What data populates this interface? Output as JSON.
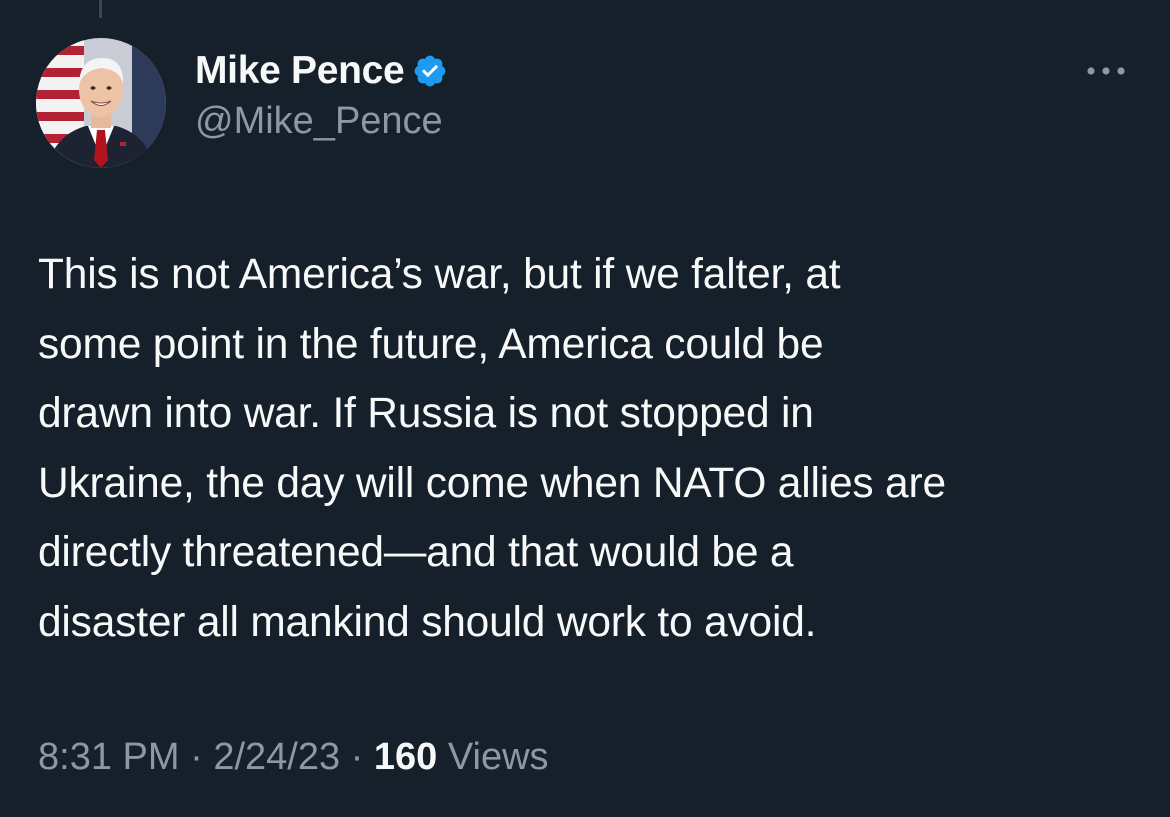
{
  "tweet": {
    "author": {
      "display_name": "Mike Pence",
      "handle": "@Mike_Pence",
      "verified": true,
      "verified_icon": "verified-badge-icon"
    },
    "text": "This is not America’s war, but if we falter, at\nsome point in the future, America could be\ndrawn into war. If Russia is not stopped in\nUkraine, the day will come when NATO allies are\ndirectly threatened—and that would be a\ndisaster all mankind should work to avoid.",
    "time": "8:31 PM",
    "date": "2/24/23",
    "separator": " · ",
    "views_count": "160",
    "views_label": " Views",
    "more_icon": "more-options-icon"
  },
  "colors": {
    "background": "#15202b",
    "text_primary": "#f7f9f9",
    "text_secondary": "#8b98a5",
    "verified_blue": "#1d9bf0"
  }
}
